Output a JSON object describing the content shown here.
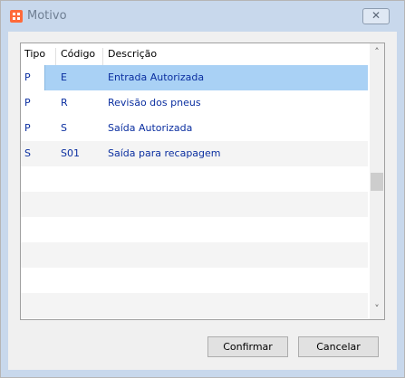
{
  "window": {
    "title": "Motivo",
    "close_glyph": "✕"
  },
  "grid": {
    "columns": [
      "Tipo",
      "Código",
      "Descrição"
    ],
    "rows": [
      {
        "tipo": "P",
        "codigo": "E",
        "descricao": "Entrada Autorizada",
        "selected": true
      },
      {
        "tipo": "P",
        "codigo": "R",
        "descricao": "Revisão dos pneus"
      },
      {
        "tipo": "P",
        "codigo": "S",
        "descricao": "Saída Autorizada"
      },
      {
        "tipo": "S",
        "codigo": "S01",
        "descricao": "Saída para recapagem"
      }
    ],
    "scroll_up_glyph": "˄",
    "scroll_down_glyph": "˅"
  },
  "buttons": {
    "confirm": "Confirmar",
    "cancel": "Cancelar"
  },
  "colors": {
    "selection": "#a9d1f5",
    "row_text": "#0b2fa0",
    "window_frame": "#c8d8ec"
  }
}
